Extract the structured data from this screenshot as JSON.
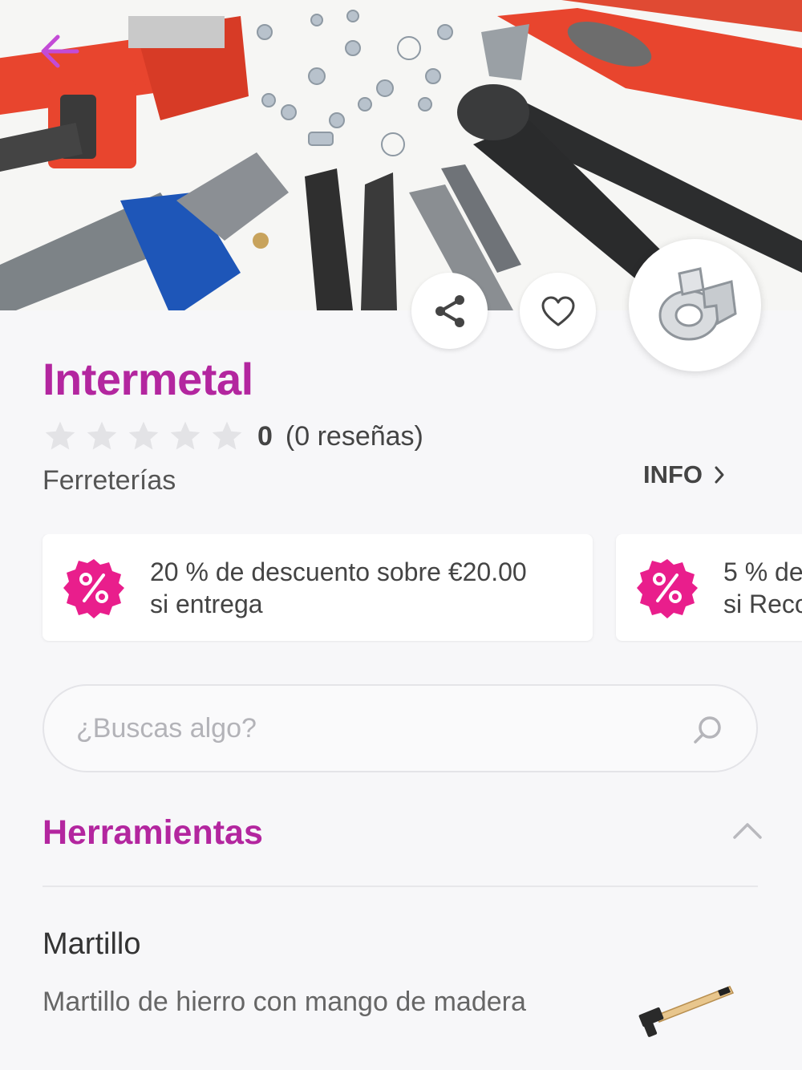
{
  "header": {
    "icons": {
      "back": "arrow-left-icon",
      "share": "share-icon",
      "favorite": "heart-icon"
    },
    "accent_color": "#b3269f",
    "back_color": "#c34bd6"
  },
  "store": {
    "name": "Intermetal",
    "rating_value": "0",
    "rating_reviews": "(0 reseñas)",
    "rating_stars": 0,
    "category": "Ferreterías",
    "info_label": "INFO"
  },
  "promotions": [
    {
      "line1": "20 % de descuento sobre €20.00",
      "line2": "si entrega",
      "badge_color": "#e91e8c"
    },
    {
      "line1": "5 % de",
      "line2": "si Reco",
      "badge_color": "#e91e8c"
    }
  ],
  "search": {
    "placeholder": "¿Buscas algo?"
  },
  "menu": {
    "section_title": "Herramientas",
    "items": [
      {
        "name": "Martillo",
        "description": "Martillo de hierro con mango de madera"
      }
    ]
  }
}
